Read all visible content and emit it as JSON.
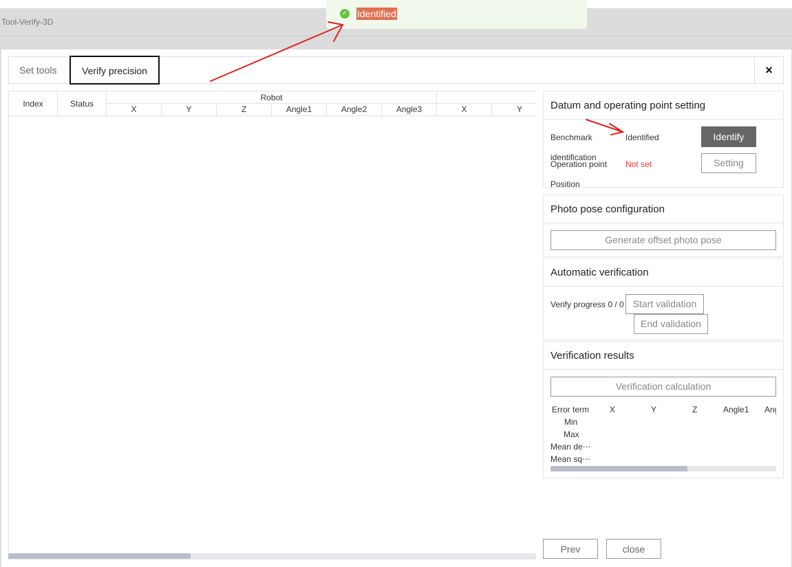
{
  "window": {
    "title": "Tool-Verify-3D"
  },
  "toast": {
    "message": "Identified"
  },
  "tabs": [
    {
      "label": "Set tools"
    },
    {
      "label": "Verify precision"
    }
  ],
  "close_icon": "×",
  "table": {
    "headers": {
      "index": "Index",
      "status": "Status",
      "robot_group": "Robot",
      "robot_cols": [
        "X",
        "Y",
        "Z",
        "Angle1",
        "Angle2",
        "Angle3"
      ],
      "next_cols": [
        "X",
        "Y"
      ]
    },
    "rows": []
  },
  "datum_panel": {
    "title": "Datum and operating point setting",
    "benchmark_label_1": "Benchmark",
    "benchmark_label_2": "identification",
    "benchmark_status": "Identified",
    "identify_button": "Identify",
    "operation_label_1": "Operation point",
    "operation_label_2": "Position",
    "operation_status": "Not set",
    "setting_button": "Setting"
  },
  "photo_panel": {
    "title": "Photo pose configuration",
    "generate_button": "Generate offset photo pose"
  },
  "auto_panel": {
    "title": "Automatic verification",
    "progress_text": "Verify progress 0 / 0",
    "start_button": "Start validation",
    "end_button": "End validation"
  },
  "results_panel": {
    "title": "Verification results",
    "calc_button": "Verification calculation",
    "columns": [
      "Error term",
      "X",
      "Y",
      "Z",
      "Angle1",
      "Ang"
    ],
    "row_labels": [
      "Min",
      "Max",
      "Mean de⋯",
      "Mean sq⋯"
    ]
  },
  "footer": {
    "prev_button": "Prev",
    "close_button": "close"
  },
  "colors": {
    "success": "#67c23a",
    "danger": "#e53935",
    "annotation": "#e0201e",
    "toast_bg": "#f0f9eb"
  }
}
